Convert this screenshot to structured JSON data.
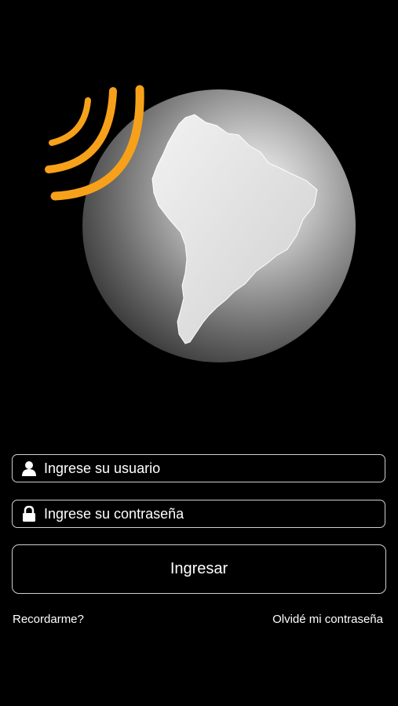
{
  "logo": {
    "icon": "south-america-globe-signal-logo",
    "wave_color": "#F7A11A",
    "continent_color": "#E6E6E6"
  },
  "login_form": {
    "username": {
      "icon": "user-icon",
      "placeholder": "Ingrese su usuario",
      "value": ""
    },
    "password": {
      "icon": "lock-icon",
      "placeholder": "Ingrese su contraseña",
      "value": ""
    },
    "submit_label": "Ingresar",
    "remember_label": "Recordarme?",
    "forgot_label": "Olvidé mi contraseña"
  },
  "colors": {
    "background": "#000000",
    "text": "#FFFFFF",
    "border": "#CFCFCF"
  }
}
